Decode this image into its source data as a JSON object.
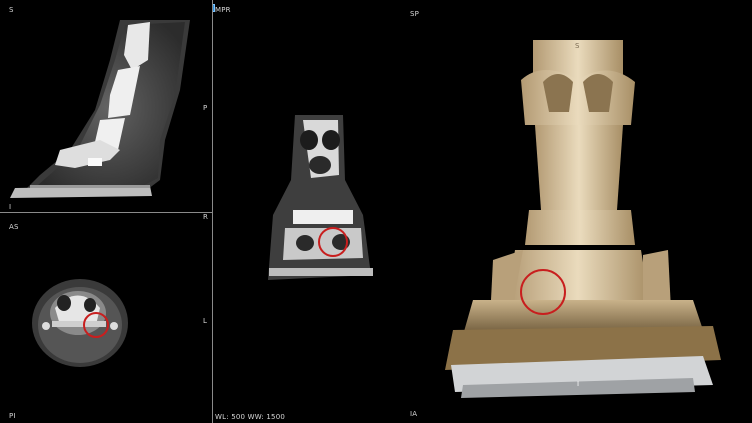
{
  "viewer": {
    "views": {
      "sagittal": {
        "top_left": "S",
        "bottom_left": "I",
        "right_top": "P"
      },
      "axial": {
        "top_left": "AS",
        "bottom_left": "PI",
        "right_top": "R",
        "right_bottom": "L"
      },
      "mpr": {
        "label": "MPR",
        "window_level": "WL: 500 WW: 1500"
      },
      "volume": {
        "top_left": "SP",
        "bottom_left": "IA",
        "bone_marker": "S",
        "base_marker": "I"
      }
    },
    "colors": {
      "annotation_circle": "#c81e1e",
      "mpr_badge": "#2f8fd8",
      "slice_marker": "#e7c21a"
    }
  }
}
